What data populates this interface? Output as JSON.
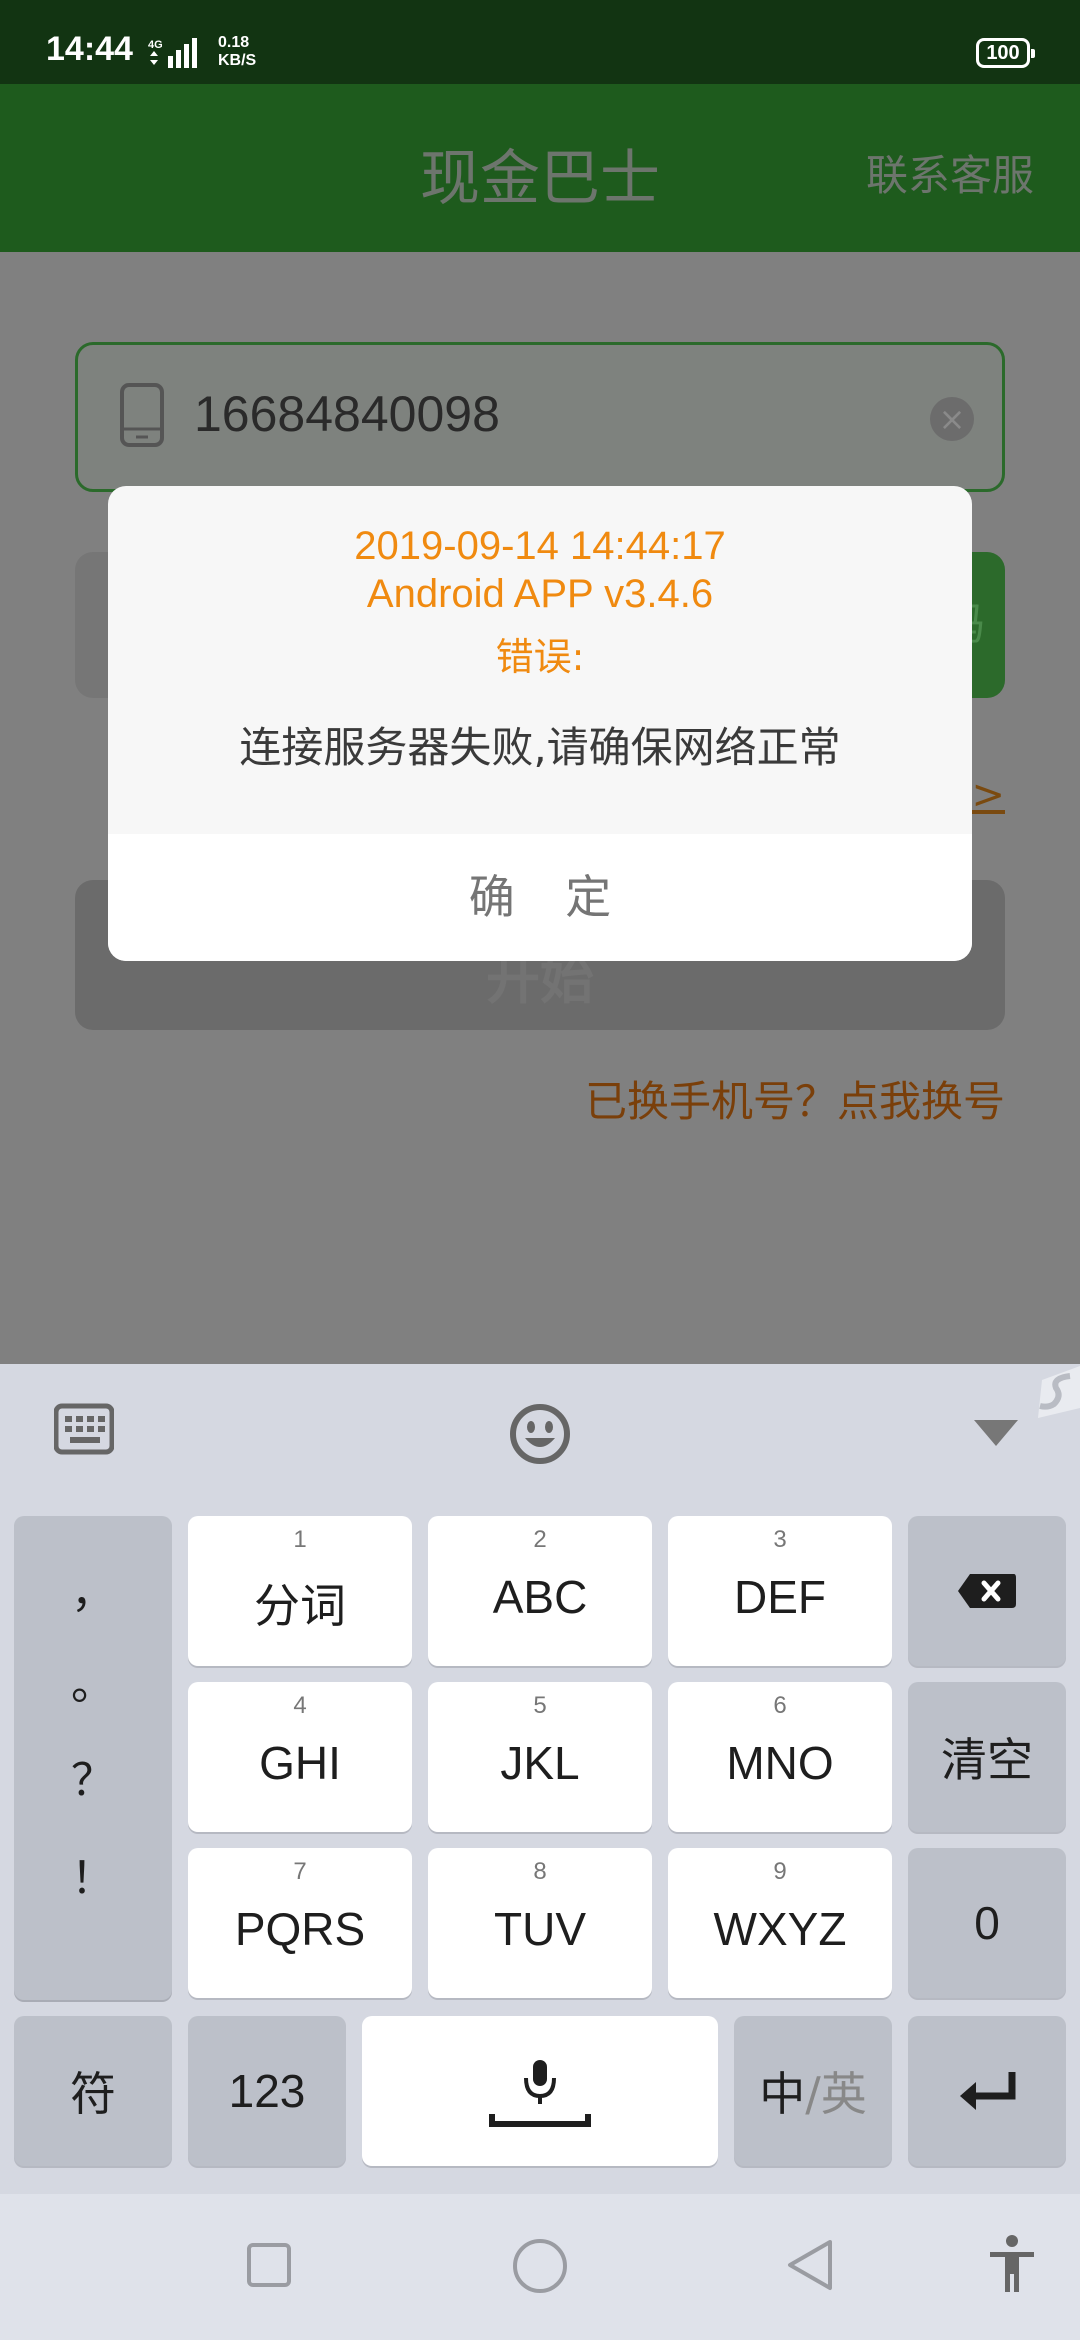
{
  "status_bar": {
    "time": "14:44",
    "network": "4G",
    "speed_value": "0.18",
    "speed_unit": "KB/S",
    "battery": "100"
  },
  "app_bar": {
    "title": "现金巴士",
    "contact": "联系客服"
  },
  "login": {
    "phone_value": "16684840098",
    "code_button": "码",
    "agree_link": ">",
    "start_button": "开始",
    "change_phone": "已换手机号？点我换号"
  },
  "dialog": {
    "timestamp": "2019-09-14 14:44:17",
    "version": "Android APP v3.4.6",
    "error_label": "错误:",
    "message": "连接服务器失败,请确保网络正常",
    "ok_button": "确 定"
  },
  "keyboard": {
    "punctuation": [
      "，",
      "。",
      "？",
      "！"
    ],
    "keys": [
      {
        "num": "1",
        "label": "分词"
      },
      {
        "num": "2",
        "label": "ABC"
      },
      {
        "num": "3",
        "label": "DEF"
      },
      {
        "num": "4",
        "label": "GHI"
      },
      {
        "num": "5",
        "label": "JKL"
      },
      {
        "num": "6",
        "label": "MNO"
      },
      {
        "num": "7",
        "label": "PQRS"
      },
      {
        "num": "8",
        "label": "TUV"
      },
      {
        "num": "9",
        "label": "WXYZ"
      }
    ],
    "clear": "清空",
    "zero": "0",
    "symbol": "符",
    "num_mode": "123",
    "lang_cn": "中",
    "lang_sep": "/",
    "lang_en": "英"
  },
  "colors": {
    "app_bar": "#1e5b1d",
    "dialog_accent": "#f08a10",
    "link_orange": "#7a3f0a"
  }
}
